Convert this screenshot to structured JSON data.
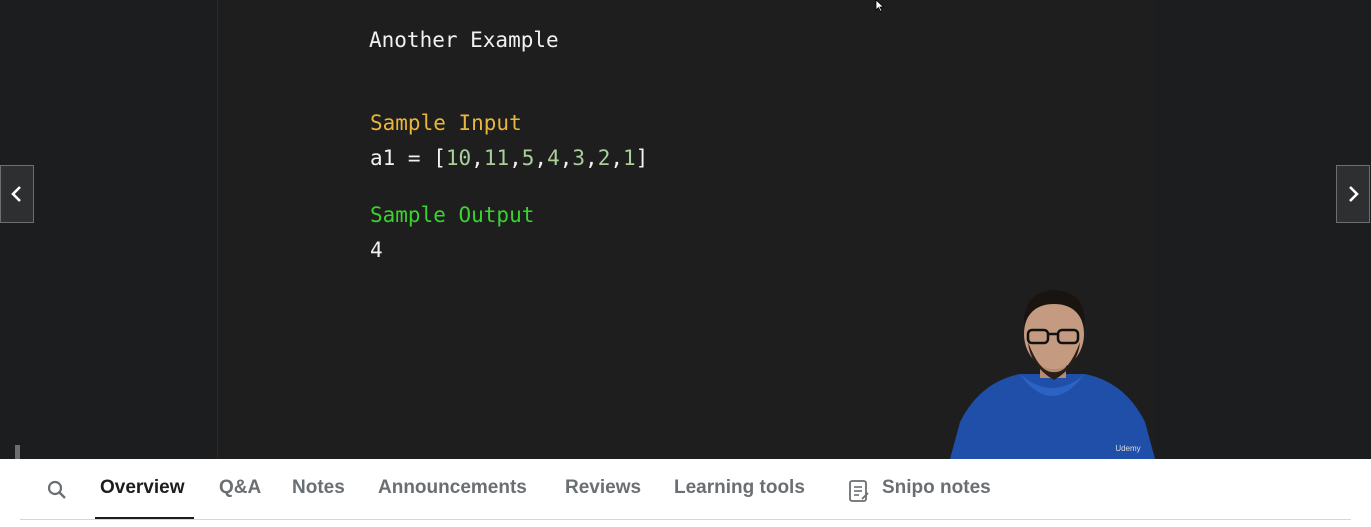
{
  "slide": {
    "title": "Another Example",
    "input_label": "Sample Input",
    "input_var": "a1 = [",
    "input_values": [
      "10",
      "11",
      "5",
      "4",
      "3",
      "2",
      "1"
    ],
    "input_close": "]",
    "output_label": "Sample Output",
    "output_value": "4"
  },
  "webcam": {
    "watermark": "Udemy"
  },
  "tabs": [
    {
      "label": "Overview",
      "active": true
    },
    {
      "label": "Q&A"
    },
    {
      "label": "Notes"
    },
    {
      "label": "Announcements"
    },
    {
      "label": "Reviews"
    },
    {
      "label": "Learning tools"
    },
    {
      "label": "Snipo notes"
    }
  ],
  "icons": {
    "search": "search-icon",
    "prev": "chevron-left-icon",
    "next": "chevron-right-icon",
    "snipo": "notes-icon",
    "cursor": "mouse-cursor-icon"
  },
  "colors": {
    "input_label": "#e9b53a",
    "output_label": "#39d32f",
    "numbers": "#a9cf9a"
  }
}
